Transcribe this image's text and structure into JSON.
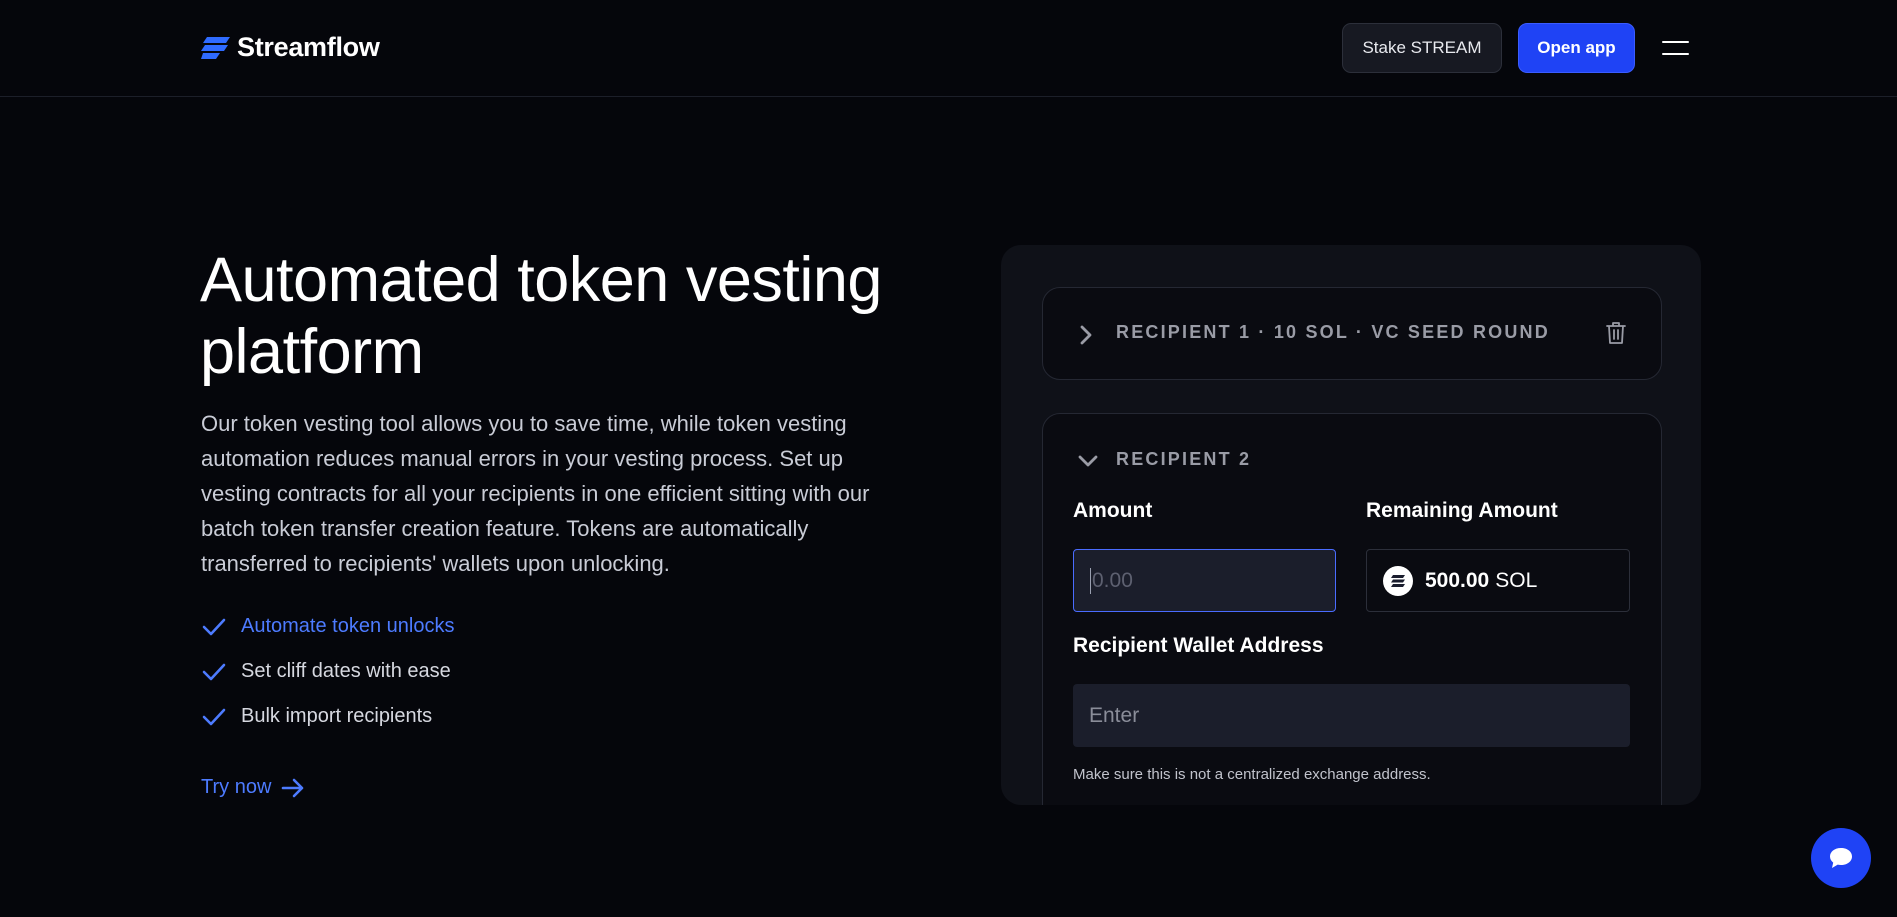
{
  "header": {
    "brand": "Streamflow",
    "stake_label": "Stake STREAM",
    "open_app_label": "Open app"
  },
  "hero": {
    "title": "Automated token vesting platform",
    "description": "Our token vesting tool allows you to save time, while token vesting automation reduces manual errors in your vesting process. Set up vesting contracts for all your recipients in one efficient sitting with our batch token transfer creation feature. Tokens are automatically transferred to recipients' wallets upon unlocking.",
    "features": [
      {
        "label": "Automate token unlocks",
        "active": true
      },
      {
        "label": "Set cliff dates with ease",
        "active": false
      },
      {
        "label": "Bulk import recipients",
        "active": false
      }
    ],
    "try_label": "Try now"
  },
  "card": {
    "recipient1_label": "RECIPIENT 1 · 10 SOL · VC SEED ROUND",
    "recipient2_label": "RECIPIENT 2",
    "amount_label": "Amount",
    "amount_placeholder": "0.00",
    "remaining_label": "Remaining Amount",
    "remaining_value": "500.00",
    "remaining_unit": "SOL",
    "wallet_label": "Recipient Wallet Address",
    "wallet_placeholder": "Enter",
    "hint": "Make sure this is not a centralized exchange address."
  },
  "colors": {
    "background": "#05060b",
    "accent": "#1f43f5",
    "link": "#4d7bff"
  }
}
